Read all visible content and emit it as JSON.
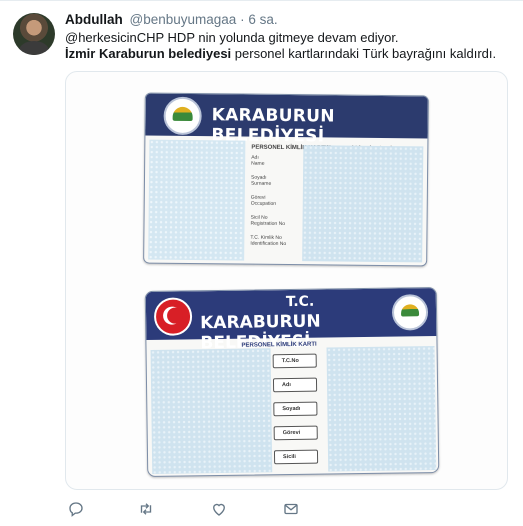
{
  "tweet": {
    "author_name": "Abdullah",
    "handle": "@benbuyumagaa",
    "separator": "·",
    "time": "6 sa.",
    "line1": "@herkesicinCHP HDP nin yolunda gitmeye devam ediyor.",
    "line2_bold": "İzmir Karaburun belediyesi",
    "line2_rest": " personel kartlarındaki Türk bayrağını kaldırdı."
  },
  "media": {
    "card1": {
      "title": "KARABURUN BELEDİYESİ",
      "subtitle": "PERSONEL KİMLİK KARTI/Personel Identity Card",
      "fields": [
        {
          "tr": "Adı",
          "en": "Name"
        },
        {
          "tr": "Soyadı",
          "en": "Surname"
        },
        {
          "tr": "Görevi",
          "en": "Occupation"
        },
        {
          "tr": "Sicil No",
          "en": "Registration No"
        },
        {
          "tr": "T.C. Kimlik No",
          "en": "Identification No"
        }
      ]
    },
    "card2": {
      "tc": "T.C.",
      "title": "KARABURUN BELEDİYESİ",
      "subtitle": "PERSONEL KİMLİK KARTI",
      "fields": [
        "T.C.No",
        "Adı",
        "Soyadı",
        "Görevi",
        "Sicili"
      ]
    }
  },
  "actions": [
    "reply-icon",
    "retweet-icon",
    "like-icon",
    "dm-icon"
  ],
  "colors": {
    "card_band": "#2c3b6e",
    "flag_red": "#d81f26",
    "icon_gray": "#657786"
  }
}
